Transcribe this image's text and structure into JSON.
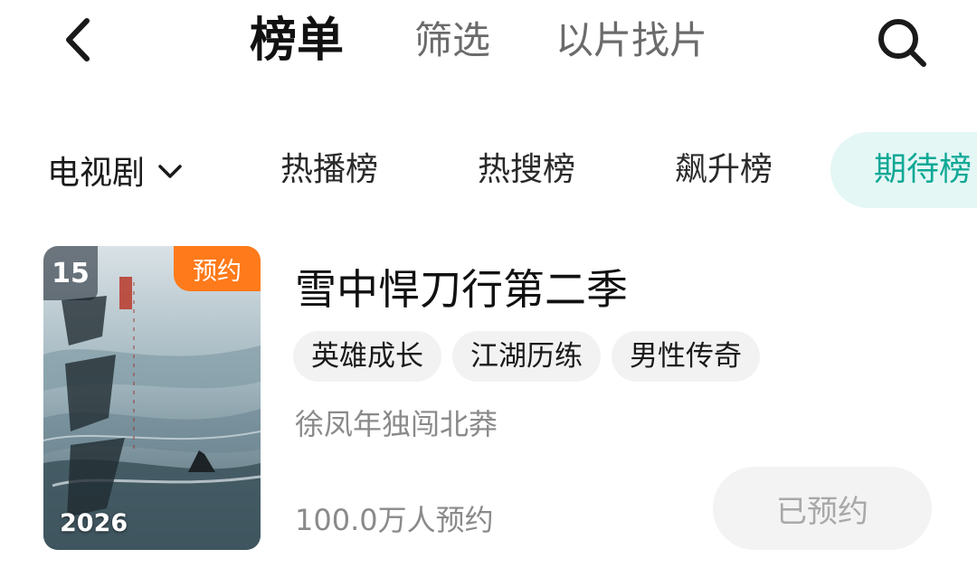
{
  "header": {
    "back_icon": "chevron-left-icon",
    "tabs": [
      {
        "label": "榜单",
        "active": true
      },
      {
        "label": "筛选",
        "active": false
      },
      {
        "label": "以片找片",
        "active": false
      }
    ],
    "search_icon": "search-icon"
  },
  "filters": {
    "category": "电视剧",
    "category_icon": "chevron-down-icon",
    "tabs": [
      {
        "label": "热播榜",
        "active": false
      },
      {
        "label": "热搜榜",
        "active": false
      },
      {
        "label": "飙升榜",
        "active": false
      },
      {
        "label": "期待榜",
        "active": true
      }
    ],
    "active_color": "#10a896"
  },
  "items": [
    {
      "rank": "15",
      "badge": "预约",
      "year": "2026",
      "title": "雪中悍刀行第二季",
      "tags": [
        "英雄成长",
        "江湖历练",
        "男性传奇"
      ],
      "description": "徐凤年独闯北莽",
      "reservation_count": "100.0万人预约",
      "button_label": "已预约",
      "badge_color": "#ff7a1a"
    }
  ]
}
